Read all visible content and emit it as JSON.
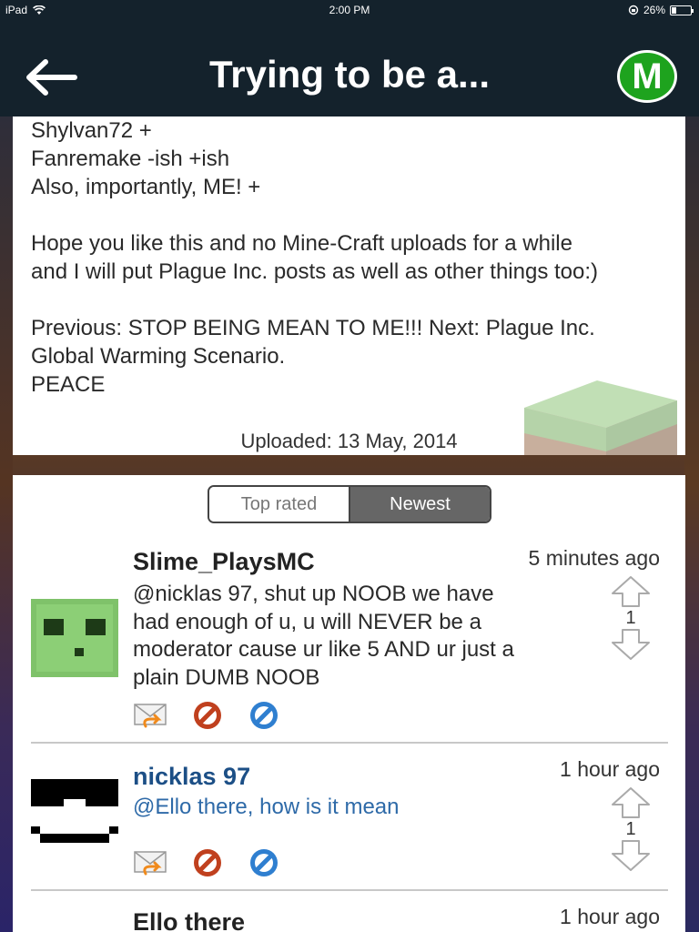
{
  "status": {
    "device": "iPad",
    "time": "2:00 PM",
    "battery": "26%",
    "battery_level": 0.26
  },
  "nav": {
    "title": "Trying to be a...",
    "logo_letter": "M"
  },
  "description": {
    "lines": [
      "Shylvan72 +",
      "Fanremake -ish +ish",
      "Also, importantly, ME! +",
      "",
      "Hope you like this and no Mine-Craft uploads for a while",
      "and I will put Plague Inc. posts as well as other things too:)",
      "",
      "Previous: STOP BEING MEAN TO ME!!! Next: Plague Inc.",
      "Global Warming Scenario.",
      "PEACE"
    ],
    "uploaded": "Uploaded: 13 May, 2014"
  },
  "sort_tabs": {
    "top_rated": "Top rated",
    "newest": "Newest",
    "selected": "Newest"
  },
  "comments": [
    {
      "author": "Slime_PlaysMC",
      "time": "5 minutes ago",
      "text": [
        "@nicklas 97, shut up NOOB we have",
        "had enough of u, u will NEVER be a",
        "moderator cause ur like 5 AND ur just a",
        "plain DUMB NOOB"
      ],
      "votes": "1"
    },
    {
      "author": "nicklas 97",
      "time": "1 hour ago",
      "text": [
        "@Ello there, how is it mean"
      ],
      "votes": "1"
    },
    {
      "author": "Ello there",
      "time": "1 hour ago",
      "text": [],
      "votes": ""
    }
  ],
  "colors": {
    "nav_bg": "#14222c",
    "logo_green": "#1ea31e",
    "author_blue": "#1c4f86",
    "reply_blue": "#2e6aa8"
  }
}
